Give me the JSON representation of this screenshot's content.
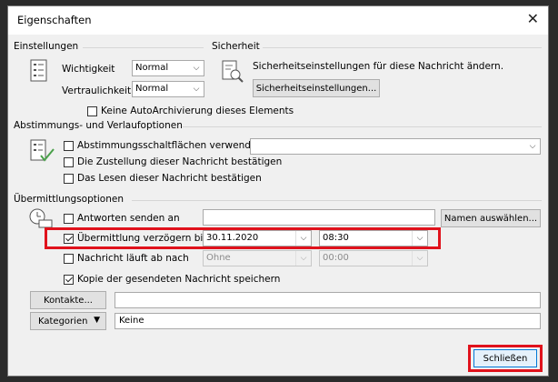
{
  "dialog": {
    "title": "Eigenschaften"
  },
  "einstellungen": {
    "group_label": "Einstellungen",
    "wichtigkeit_label": "Wichtigkeit",
    "wichtigkeit_value": "Normal",
    "vertraulichkeit_label": "Vertraulichkeit",
    "vertraulichkeit_value": "Normal",
    "no_autoarchive_label": "Keine AutoArchivierung dieses Elements"
  },
  "sicherheit": {
    "group_label": "Sicherheit",
    "description": "Sicherheitseinstellungen für diese Nachricht ändern.",
    "button_label": "Sicherheitseinstellungen..."
  },
  "abstimmung": {
    "group_label": "Abstimmungs- und Verlaufoptionen",
    "voting_buttons_label": "Abstimmungsschaltflächen verwenden",
    "voting_buttons_value": "",
    "delivery_receipt_label": "Die Zustellung dieser Nachricht bestätigen",
    "read_receipt_label": "Das Lesen dieser Nachricht bestätigen"
  },
  "uebermittlung": {
    "group_label": "Übermittlungsoptionen",
    "reply_to_label": "Antworten senden an",
    "reply_to_value": "",
    "names_button_label": "Namen auswählen...",
    "delay_label": "Übermittlung verzögern bis",
    "delay_checked": true,
    "delay_date": "30.11.2020",
    "delay_time": "08:30",
    "expires_label": "Nachricht läuft ab nach",
    "expires_checked": false,
    "expires_date": "Ohne",
    "expires_time": "00:00",
    "save_copy_label": "Kopie der gesendeten Nachricht speichern",
    "save_copy_checked": true
  },
  "kontakte": {
    "button_label": "Kontakte...",
    "value": ""
  },
  "kategorien": {
    "button_label": "Kategorien",
    "value": "Keine"
  },
  "footer": {
    "close_label": "Schließen"
  },
  "colors": {
    "highlight": "#e0121c"
  }
}
